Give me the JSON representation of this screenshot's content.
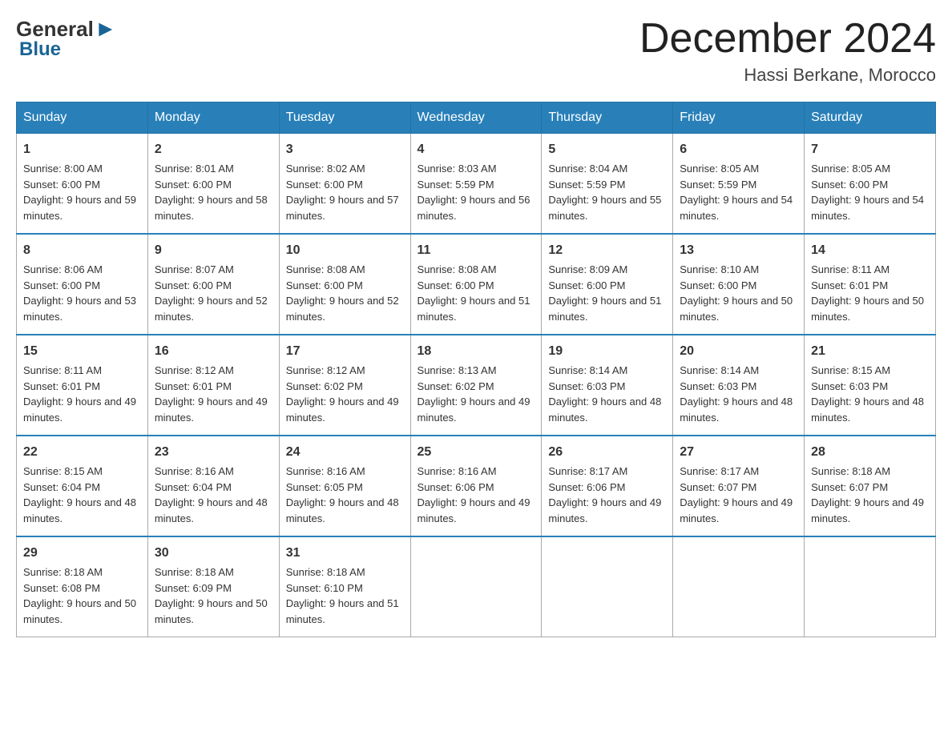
{
  "header": {
    "logo_general": "General",
    "logo_blue": "Blue",
    "month_title": "December 2024",
    "location": "Hassi Berkane, Morocco"
  },
  "days_of_week": [
    "Sunday",
    "Monday",
    "Tuesday",
    "Wednesday",
    "Thursday",
    "Friday",
    "Saturday"
  ],
  "weeks": [
    [
      {
        "day": "1",
        "sunrise": "8:00 AM",
        "sunset": "6:00 PM",
        "daylight": "9 hours and 59 minutes."
      },
      {
        "day": "2",
        "sunrise": "8:01 AM",
        "sunset": "6:00 PM",
        "daylight": "9 hours and 58 minutes."
      },
      {
        "day": "3",
        "sunrise": "8:02 AM",
        "sunset": "6:00 PM",
        "daylight": "9 hours and 57 minutes."
      },
      {
        "day": "4",
        "sunrise": "8:03 AM",
        "sunset": "5:59 PM",
        "daylight": "9 hours and 56 minutes."
      },
      {
        "day": "5",
        "sunrise": "8:04 AM",
        "sunset": "5:59 PM",
        "daylight": "9 hours and 55 minutes."
      },
      {
        "day": "6",
        "sunrise": "8:05 AM",
        "sunset": "5:59 PM",
        "daylight": "9 hours and 54 minutes."
      },
      {
        "day": "7",
        "sunrise": "8:05 AM",
        "sunset": "6:00 PM",
        "daylight": "9 hours and 54 minutes."
      }
    ],
    [
      {
        "day": "8",
        "sunrise": "8:06 AM",
        "sunset": "6:00 PM",
        "daylight": "9 hours and 53 minutes."
      },
      {
        "day": "9",
        "sunrise": "8:07 AM",
        "sunset": "6:00 PM",
        "daylight": "9 hours and 52 minutes."
      },
      {
        "day": "10",
        "sunrise": "8:08 AM",
        "sunset": "6:00 PM",
        "daylight": "9 hours and 52 minutes."
      },
      {
        "day": "11",
        "sunrise": "8:08 AM",
        "sunset": "6:00 PM",
        "daylight": "9 hours and 51 minutes."
      },
      {
        "day": "12",
        "sunrise": "8:09 AM",
        "sunset": "6:00 PM",
        "daylight": "9 hours and 51 minutes."
      },
      {
        "day": "13",
        "sunrise": "8:10 AM",
        "sunset": "6:00 PM",
        "daylight": "9 hours and 50 minutes."
      },
      {
        "day": "14",
        "sunrise": "8:11 AM",
        "sunset": "6:01 PM",
        "daylight": "9 hours and 50 minutes."
      }
    ],
    [
      {
        "day": "15",
        "sunrise": "8:11 AM",
        "sunset": "6:01 PM",
        "daylight": "9 hours and 49 minutes."
      },
      {
        "day": "16",
        "sunrise": "8:12 AM",
        "sunset": "6:01 PM",
        "daylight": "9 hours and 49 minutes."
      },
      {
        "day": "17",
        "sunrise": "8:12 AM",
        "sunset": "6:02 PM",
        "daylight": "9 hours and 49 minutes."
      },
      {
        "day": "18",
        "sunrise": "8:13 AM",
        "sunset": "6:02 PM",
        "daylight": "9 hours and 49 minutes."
      },
      {
        "day": "19",
        "sunrise": "8:14 AM",
        "sunset": "6:03 PM",
        "daylight": "9 hours and 48 minutes."
      },
      {
        "day": "20",
        "sunrise": "8:14 AM",
        "sunset": "6:03 PM",
        "daylight": "9 hours and 48 minutes."
      },
      {
        "day": "21",
        "sunrise": "8:15 AM",
        "sunset": "6:03 PM",
        "daylight": "9 hours and 48 minutes."
      }
    ],
    [
      {
        "day": "22",
        "sunrise": "8:15 AM",
        "sunset": "6:04 PM",
        "daylight": "9 hours and 48 minutes."
      },
      {
        "day": "23",
        "sunrise": "8:16 AM",
        "sunset": "6:04 PM",
        "daylight": "9 hours and 48 minutes."
      },
      {
        "day": "24",
        "sunrise": "8:16 AM",
        "sunset": "6:05 PM",
        "daylight": "9 hours and 48 minutes."
      },
      {
        "day": "25",
        "sunrise": "8:16 AM",
        "sunset": "6:06 PM",
        "daylight": "9 hours and 49 minutes."
      },
      {
        "day": "26",
        "sunrise": "8:17 AM",
        "sunset": "6:06 PM",
        "daylight": "9 hours and 49 minutes."
      },
      {
        "day": "27",
        "sunrise": "8:17 AM",
        "sunset": "6:07 PM",
        "daylight": "9 hours and 49 minutes."
      },
      {
        "day": "28",
        "sunrise": "8:18 AM",
        "sunset": "6:07 PM",
        "daylight": "9 hours and 49 minutes."
      }
    ],
    [
      {
        "day": "29",
        "sunrise": "8:18 AM",
        "sunset": "6:08 PM",
        "daylight": "9 hours and 50 minutes."
      },
      {
        "day": "30",
        "sunrise": "8:18 AM",
        "sunset": "6:09 PM",
        "daylight": "9 hours and 50 minutes."
      },
      {
        "day": "31",
        "sunrise": "8:18 AM",
        "sunset": "6:10 PM",
        "daylight": "9 hours and 51 minutes."
      },
      null,
      null,
      null,
      null
    ]
  ]
}
